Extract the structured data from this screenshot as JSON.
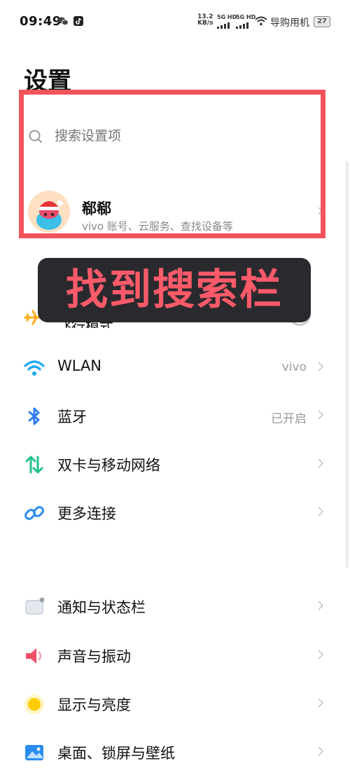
{
  "status_bar": {
    "time": "09:49",
    "speed_value": "13.2",
    "speed_unit": "KB/s",
    "sim1": "5G HD",
    "sim2": "5G HD",
    "carrier": "导购用机",
    "battery": "27"
  },
  "page_title": "设置",
  "search": {
    "placeholder": "搜索设置项",
    "value": ""
  },
  "account": {
    "name": "郗郗",
    "subtitle": "vivo 账号、云服务、查找设备等"
  },
  "overlay_banner": "找到搜索栏",
  "partially_hidden_row": {
    "label": "飞行模式",
    "icon": "airplane-icon"
  },
  "settings": [
    {
      "label": "WLAN",
      "value": "vivo",
      "icon": "wifi-icon"
    },
    {
      "label": "蓝牙",
      "value": "已开启",
      "icon": "bluetooth-icon"
    },
    {
      "label": "双卡与移动网络",
      "value": "",
      "icon": "mobile-network-icon"
    },
    {
      "label": "更多连接",
      "value": "",
      "icon": "link-icon"
    },
    {
      "label": "通知与状态栏",
      "value": "",
      "icon": "notification-icon"
    },
    {
      "label": "声音与振动",
      "value": "",
      "icon": "sound-icon"
    },
    {
      "label": "显示与亮度",
      "value": "",
      "icon": "brightness-icon"
    },
    {
      "label": "桌面、锁屏与壁纸",
      "value": "",
      "icon": "wallpaper-icon"
    }
  ],
  "colors": {
    "highlight": "#f2545e",
    "banner_bg": "#2a2a2e",
    "banner_text": "#ff5a6a",
    "wifi": "#1aa7f0",
    "bluetooth": "#2f7df6",
    "mobile_network": "#22c28a",
    "link": "#2a8cf0",
    "sound": "#f1506a",
    "brightness": "#ffcc00",
    "airplane": "#ffae21"
  }
}
